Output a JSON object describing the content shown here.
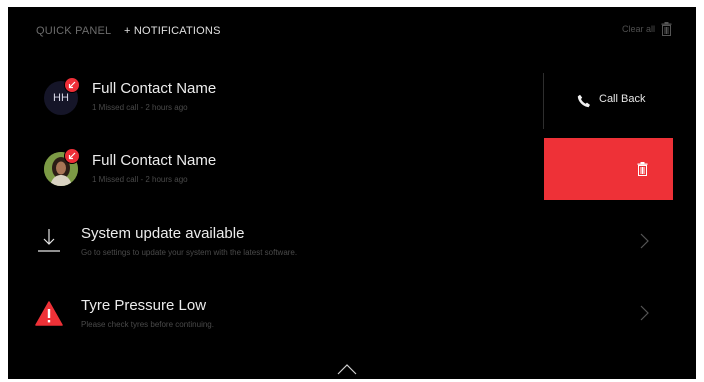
{
  "header": {
    "quick_panel_tab": "QUICK PANEL",
    "notifications_tab": "+ NOTIFICATIONS",
    "clear_all_label": "Clear all",
    "clear_all_icon": "trash-icon"
  },
  "notifications": [
    {
      "title": "Full Contact Name",
      "subtitle": "1 Missed call - 2 hours ago",
      "avatar_initials": "HH",
      "badge_icon": "missed-call-icon",
      "action_label": "Call Back",
      "action_icon": "phone-icon"
    },
    {
      "title": "Full Contact Name",
      "subtitle": "1 Missed call - 2 hours ago",
      "avatar": "contact-photo",
      "badge_icon": "missed-call-icon",
      "action_icon": "trash-icon"
    },
    {
      "title": "System update available",
      "subtitle": "Go to settings to update your system with the latest software.",
      "icon": "download-icon",
      "action_icon": "chevron-right-icon"
    },
    {
      "title": "Tyre Pressure Low",
      "subtitle": "Please check tyres before continuing.",
      "icon": "warning-icon",
      "action_icon": "chevron-right-icon"
    }
  ],
  "footer": {
    "collapse_icon": "chevron-up-icon"
  },
  "colors": {
    "background": "#000000",
    "accent_red": "#ee3137",
    "text_primary": "#ececec",
    "text_secondary": "#4a4a4a"
  }
}
